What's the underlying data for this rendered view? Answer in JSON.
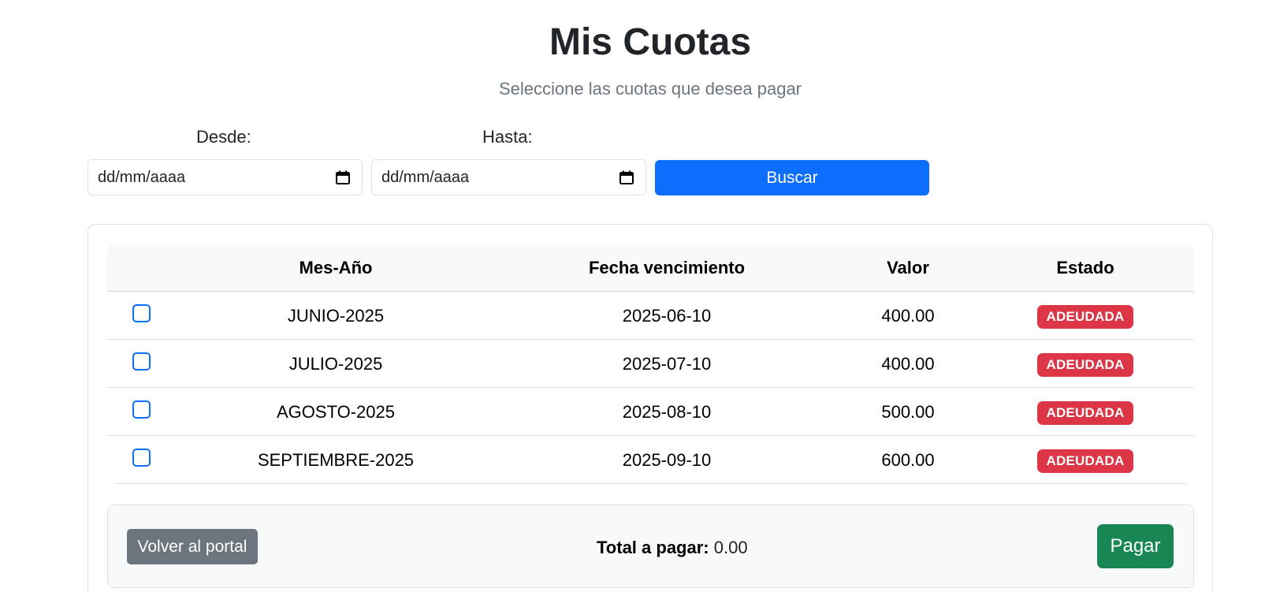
{
  "header": {
    "title": "Mis Cuotas",
    "subtitle": "Seleccione las cuotas que desea pagar"
  },
  "filters": {
    "desde_label": "Desde:",
    "hasta_label": "Hasta:",
    "desde_placeholder": "dd/mm/aaaa",
    "hasta_placeholder": "dd/mm/aaaa",
    "search_button": "Buscar"
  },
  "table": {
    "headers": [
      "",
      "Mes-Año",
      "Fecha vencimiento",
      "Valor",
      "Estado"
    ],
    "rows": [
      {
        "checked": false,
        "mes_anio": "JUNIO-2025",
        "fecha": "2025-06-10",
        "valor": "400.00",
        "estado": "ADEUDADA"
      },
      {
        "checked": false,
        "mes_anio": "JULIO-2025",
        "fecha": "2025-07-10",
        "valor": "400.00",
        "estado": "ADEUDADA"
      },
      {
        "checked": false,
        "mes_anio": "AGOSTO-2025",
        "fecha": "2025-08-10",
        "valor": "500.00",
        "estado": "ADEUDADA"
      },
      {
        "checked": false,
        "mes_anio": "SEPTIEMBRE-2025",
        "fecha": "2025-09-10",
        "valor": "600.00",
        "estado": "ADEUDADA"
      }
    ]
  },
  "footer": {
    "back_button": "Volver al portal",
    "total_label": "Total a pagar:",
    "total_value": "0.00",
    "pay_button": "Pagar"
  },
  "colors": {
    "primary": "#0d6efd",
    "danger": "#dc3545",
    "success": "#198754",
    "secondary": "#6c757d"
  },
  "icons": {
    "date_picker": "calendar-icon"
  }
}
